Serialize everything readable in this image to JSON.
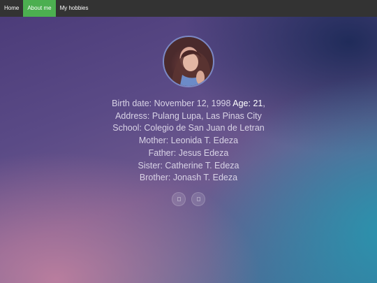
{
  "nav": {
    "items": [
      {
        "label": "Home",
        "active": false
      },
      {
        "label": "About me",
        "active": true
      },
      {
        "label": "My hobbies",
        "active": false
      }
    ]
  },
  "profile": {
    "birth_label": "Birth date:",
    "birth_value": "November 12, 1998",
    "age_label": "Age:",
    "age_value": "21",
    "address": "Address: Pulang Lupa, Las Pinas City",
    "school": "School: Colegio de San Juan de Letran",
    "mother": "Mother: Leonida T. Edeza",
    "father": "Father: Jesus Edeza",
    "sister": "Sister: Catherine T. Edeza",
    "brother": "Brother: Jonash T. Edeza"
  },
  "colors": {
    "navbar": "#333333",
    "active_tab": "#4caf50",
    "text": "#d9d3e6"
  },
  "icons": [
    "social-icon-1",
    "social-icon-2"
  ]
}
